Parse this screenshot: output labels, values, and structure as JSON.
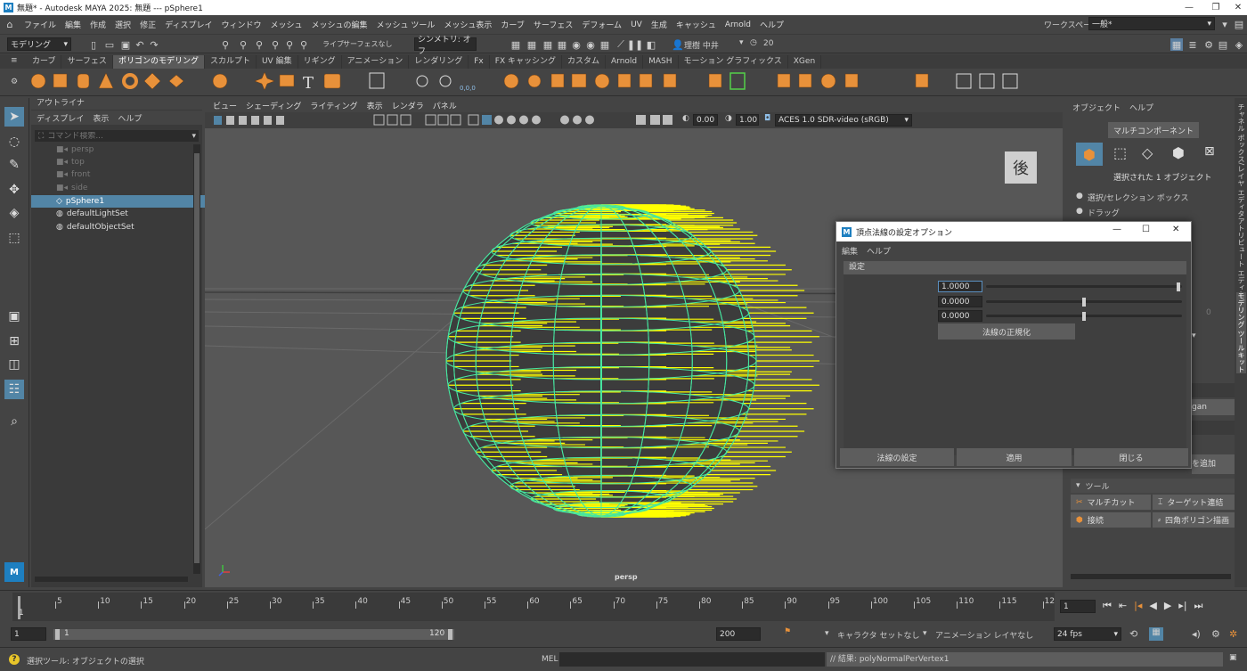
{
  "app": {
    "title": "無題* - Autodesk MAYA 2025: 無題   ---   pSphere1",
    "workspace_label": "ワークスペース:",
    "workspace_value": "一般*"
  },
  "menubar": [
    "ファイル",
    "編集",
    "作成",
    "選択",
    "修正",
    "ディスプレイ",
    "ウィンドウ",
    "メッシュ",
    "メッシュの編集",
    "メッシュ ツール",
    "メッシュ表示",
    "カーブ",
    "サーフェス",
    "デフォーム",
    "UV",
    "生成",
    "キャッシュ",
    "Arnold",
    "ヘルプ"
  ],
  "statusline": {
    "mode": "モデリング",
    "live": "ライブ",
    "live_surface": "サーフェスなし",
    "symmetry": "シンメトリ: オフ",
    "user": "理樹 中井",
    "count": "20"
  },
  "shelf": {
    "tabs": [
      "カーブ",
      "サーフェス",
      "ポリゴンのモデリング",
      "スカルプト",
      "UV 編集",
      "リギング",
      "アニメーション",
      "レンダリング",
      "Fx",
      "FX キャッシング",
      "カスタム",
      "Arnold",
      "MASH",
      "モーション グラフィックス",
      "XGen"
    ],
    "active_tab": "ポリゴンのモデリング"
  },
  "outliner": {
    "title": "アウトライナ",
    "menu": [
      "ディスプレイ",
      "表示",
      "ヘルプ"
    ],
    "search_placeholder": "コマンド検索...",
    "items": [
      {
        "label": "persp",
        "dim": true
      },
      {
        "label": "top",
        "dim": true
      },
      {
        "label": "front",
        "dim": true
      },
      {
        "label": "side",
        "dim": true
      },
      {
        "label": "pSphere1",
        "dim": false,
        "selected": true
      },
      {
        "label": "defaultLightSet",
        "dim": false
      },
      {
        "label": "defaultObjectSet",
        "dim": false
      }
    ]
  },
  "viewport": {
    "menu": [
      "ビュー",
      "シェーディング",
      "ライティング",
      "表示",
      "レンダラ",
      "パネル"
    ],
    "field1": "0.00",
    "field2": "1.00",
    "colorspace": "ACES 1.0 SDR-video (sRGB)",
    "camera_label": "persp",
    "cube_face": "後"
  },
  "right_panel": {
    "menu": [
      "オブジェクト",
      "ヘルプ"
    ],
    "multicomp_button": "マルチコンポーネント",
    "selected_text": "選択された 1 オブジェクト",
    "opt1": "選択/セレクション ボックス",
    "opt2": "ドラッグ",
    "zero": "0",
    "partial1": "gan",
    "partial2": "を追加",
    "tools_header": "ツール",
    "tools": [
      "マルチカット",
      "ターゲット連結",
      "接続",
      "四角ポリゴン描画"
    ]
  },
  "vertical_tabs": [
    "チャネル ボックス/レイヤ エディタ",
    "アトリビュート エディタ",
    "モデリング ツールキット"
  ],
  "dialog": {
    "title": "頂点法線の設定オプション",
    "menu": [
      "編集",
      "ヘルプ"
    ],
    "section": "設定",
    "fields": [
      {
        "label": "X 値:",
        "value": "1.0000",
        "fraction": 1.0
      },
      {
        "label": "Y 値:",
        "value": "0.0000",
        "fraction": 0.5
      },
      {
        "label": "Z 値:",
        "value": "0.0000",
        "fraction": 0.5
      }
    ],
    "normalize_button": "法線の正規化",
    "buttons": [
      "法線の設定",
      "適用",
      "閉じる"
    ]
  },
  "timeline": {
    "ticks": [
      "5",
      "10",
      "15",
      "20",
      "25",
      "30",
      "35",
      "40",
      "45",
      "50",
      "55",
      "60",
      "65",
      "70",
      "75",
      "80",
      "85",
      "90",
      "95",
      "100",
      "105",
      "110",
      "115",
      "12"
    ],
    "first_frame": "1",
    "current_frame": "1"
  },
  "range": {
    "start": "1",
    "inner_start": "1",
    "inner_end": "120",
    "end": "200",
    "character_set": "キャラクタ セットなし",
    "anim_layer": "アニメーション レイヤなし",
    "fps": "24 fps"
  },
  "commandline": {
    "help_text": "選択ツール: オブジェクトの選択",
    "lang": "MEL",
    "result": "// 結果: polyNormalPerVertex1"
  },
  "colors": {
    "accent_orange": "#e8913a",
    "selection_blue": "#5285a6",
    "wire_green": "#46e6a0",
    "normal_yellow": "#ffff00"
  }
}
